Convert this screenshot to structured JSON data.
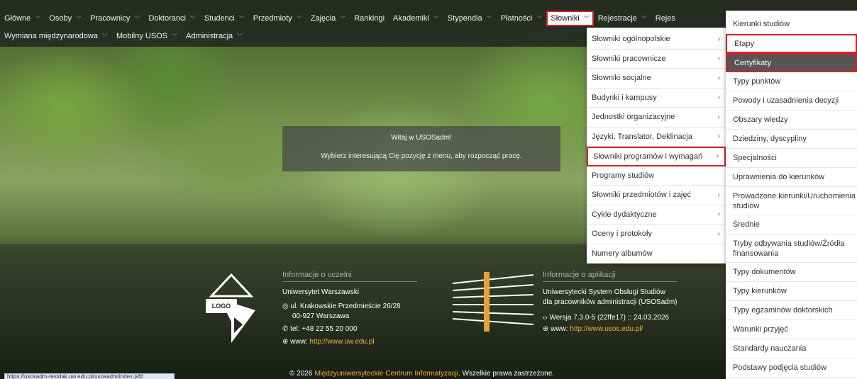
{
  "nav": {
    "row1": [
      {
        "label": "Główne",
        "chev": true
      },
      {
        "label": "Osoby",
        "chev": true
      },
      {
        "label": "Pracownicy",
        "chev": true
      },
      {
        "label": "Doktoranci",
        "chev": true
      },
      {
        "label": "Studenci",
        "chev": true
      },
      {
        "label": "Przedmioty",
        "chev": true
      },
      {
        "label": "Zajęcia",
        "chev": true
      },
      {
        "label": "Rankingi",
        "chev": false
      },
      {
        "label": "Akademiki",
        "chev": true
      },
      {
        "label": "Stypendia",
        "chev": true
      },
      {
        "label": "Płatności",
        "chev": true
      },
      {
        "label": "Słowniki",
        "chev": true,
        "active": true
      },
      {
        "label": "Rejestracje",
        "chev": true
      },
      {
        "label": "Rejes",
        "chev": false
      }
    ],
    "row2": [
      {
        "label": "Wymiana międzynarodowa",
        "chev": true
      },
      {
        "label": "Mobilny USOS",
        "chev": true
      },
      {
        "label": "Administracja",
        "chev": true
      }
    ]
  },
  "welcome": {
    "title": "Witaj w USOSadm!",
    "subtitle": "Wybierz interesującą Cię pozycję z menu, aby rozpocząć pracę."
  },
  "menu1": [
    {
      "label": "Słowniki ogólnopolskie",
      "sub": true
    },
    {
      "label": "Słowniki pracownicze",
      "sub": true
    },
    {
      "label": "Słowniki socjalne",
      "sub": true
    },
    {
      "label": "Budynki i kampusy",
      "sub": true
    },
    {
      "label": "Jednostki organizacyjne",
      "sub": true
    },
    {
      "label": "Języki, Translator, Deklinacja",
      "sub": true
    },
    {
      "label": "Słowniki programów i wymagań",
      "sub": true,
      "highlight": true
    },
    {
      "label": "Programy studiów",
      "sub": false
    },
    {
      "label": "Słowniki przedmiotów i zajęć",
      "sub": true
    },
    {
      "label": "Cykle dydaktyczne",
      "sub": true
    },
    {
      "label": "Oceny i protokoły",
      "sub": true
    },
    {
      "label": "Numery albumów",
      "sub": false
    }
  ],
  "menu2": [
    {
      "label": "Kierunki studiów"
    },
    {
      "label": "Etapy",
      "highlight": true
    },
    {
      "label": "Certyfikaty",
      "selected": true
    },
    {
      "label": "Typy punktów"
    },
    {
      "label": "Powody i uzasadnienia decyzji"
    },
    {
      "label": "Obszary wiedzy"
    },
    {
      "label": "Dziedziny, dyscypliny"
    },
    {
      "label": "Specjalności"
    },
    {
      "label": "Uprawnienia do kierunków"
    },
    {
      "label": "Prowadzone kierunki/Uruchomienia studiów"
    },
    {
      "label": "Średnie"
    },
    {
      "label": "Tryby odbywania studiów/Źródła finansowania"
    },
    {
      "label": "Typy dokumentów"
    },
    {
      "label": "Typy kierunków"
    },
    {
      "label": "Typy egzaminów doktorskich"
    },
    {
      "label": "Warunki przyjęć"
    },
    {
      "label": "Standardy nauczania"
    },
    {
      "label": "Podstawy podjęcia studiów"
    }
  ],
  "footer": {
    "logo_text": "LOGO",
    "uni_heading": "Informacje o uczelni",
    "uni_name": "Uniwersytet Warszawski",
    "address_line1": "ul. Krakowskie Przedmieście 26/28",
    "address_line2": "00-927 Warszawa",
    "phone": "tel: +48 22 55 20 000",
    "www_label": "www:",
    "uni_url": "http://www.uw.edu.pl",
    "app_heading": "Informacje o aplikacji",
    "app_name_line1": "Uniwersytecki System Obsługi Studiów",
    "app_name_line2": "dla pracowników administracji (USOSadm)",
    "version": "Wersja 7.3.0-5 (22ffe17) :: 24.03.2026",
    "app_url": "http://www.usos.edu.pl/",
    "copyright_prefix": "© 2026",
    "copyright_link": "Międzyuniwersyteckie Centrum Informatyzacji",
    "copyright_suffix": ". Wszelkie prawa zastrzeżone."
  },
  "statusbar": "https://usosadm-testdak.uw.edu.pl/usosadm/index.jsf#",
  "colors": {
    "accent_red": "#d6202a",
    "link": "#e8b23a"
  }
}
